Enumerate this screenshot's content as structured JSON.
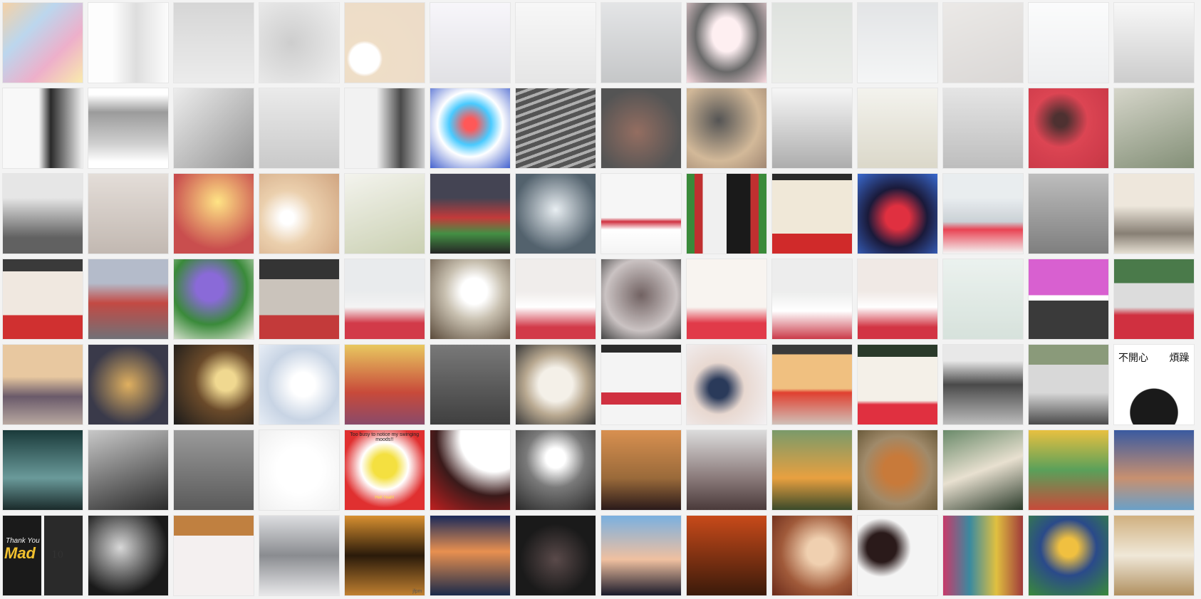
{
  "mosaic": {
    "columns": 14,
    "rows": 7,
    "tiles": [
      {
        "bg": "linear-gradient(135deg,#e89a3a,#6aa5d8,#d84f8a,#f2d24a)",
        "fade": 0.55
      },
      {
        "bg": "linear-gradient(90deg,#f4f4f4 30%,#5a5a5a 60%,#f0f0f0)",
        "fade": 0.8
      },
      {
        "bg": "linear-gradient(180deg,#8a8a8a,#c8c8c8)",
        "fade": 0.65
      },
      {
        "bg": "radial-gradient(circle at 40% 50%,#3a3a3a,#bdbdbd)",
        "fade": 0.75
      },
      {
        "bg": "radial-gradient(circle at 25% 70%,#ffffff 18%,#d0a060 22%,#c89a62)",
        "fade": 0.65
      },
      {
        "bg": "linear-gradient(180deg,#d8d0e8,#6a6a7a)",
        "fade": 0.8
      },
      {
        "bg": "linear-gradient(180deg,#dcdcdc,#8c8c8c)",
        "fade": 0.78
      },
      {
        "bg": "linear-gradient(180deg,#b0b4b8,#5a5e62)",
        "fade": 0.65
      },
      {
        "bg": "radial-gradient(ellipse at 50% 40%,#fde6ea 25%,#1a1a1a 55%,#f6c8d0)",
        "fade": 0.35
      },
      {
        "bg": "linear-gradient(180deg,#6a7a6a,#a8b0a0)",
        "fade": 0.78
      },
      {
        "bg": "linear-gradient(180deg,#9aa0a6,#d8dcde)",
        "fade": 0.72
      },
      {
        "bg": "linear-gradient(160deg,#b8b0a8,#7a706a)",
        "fade": 0.72
      },
      {
        "bg": "linear-gradient(180deg,#f0f2f4,#c0c4c8)",
        "fade": 0.72
      },
      {
        "bg": "linear-gradient(180deg,#e4e4e4,#4a4a4a)",
        "fade": 0.72
      },
      {
        "bg": "linear-gradient(90deg,#f8f8f8 45%,#2a2a2a 60%,#f0f0f0)",
        "fade": 0.0
      },
      {
        "bg": "linear-gradient(180deg,#ffffff 8%,#8a8a8a 30%,#c8c8c8 70%,#ffffff 92%)",
        "fade": 0.15
      },
      {
        "bg": "linear-gradient(135deg,#e8e8e8,#7a7a7a)",
        "fade": 0.2
      },
      {
        "bg": "linear-gradient(180deg,#e6e6e6,#bcbcbc)",
        "fade": 0.2
      },
      {
        "bg": "linear-gradient(90deg,#f0f0f0 40%,#2a2a2a 70%,#c8c8c8)",
        "fade": 0.15
      },
      {
        "bg": "radial-gradient(circle at 50% 45%,#ff5050 10%,#40c8ff 35%,#ffffff 55%,#3a5acc)",
        "fade": 0.05
      },
      {
        "bg": "repeating-linear-gradient(160deg,#2a2a2a 0 6px,#9a9a9a 6px 10px)",
        "fade": 0.2
      },
      {
        "bg": "radial-gradient(circle at 45% 55%,#7a4a3a,#2a2a2a 70%)",
        "fade": 0.2
      },
      {
        "bg": "radial-gradient(circle at 40% 40%,#2a2a2a,#c8a880 60%,#8a6a50)",
        "fade": 0.2
      },
      {
        "bg": "linear-gradient(180deg,#f2f2f2,#8a8a8a)",
        "fade": 0.3
      },
      {
        "bg": "linear-gradient(180deg,#f0efe8,#cfcbb8)",
        "fade": 0.25
      },
      {
        "bg": "linear-gradient(180deg,#dcdcdc,#a8a8a8)",
        "fade": 0.25
      },
      {
        "bg": "radial-gradient(circle at 40% 40%,#3a1a1a 10%,#d83040 40%,#c02030)",
        "fade": 0.1
      },
      {
        "bg": "linear-gradient(160deg,#c8c8b8,#5a6a4a)",
        "fade": 0.25
      },
      {
        "bg": "linear-gradient(180deg,#e0e0e0 30%,#3a3a3a 80%)",
        "fade": 0.2
      },
      {
        "bg": "linear-gradient(180deg,#d8cfc8,#a89a90)",
        "fade": 0.3
      },
      {
        "bg": "radial-gradient(circle at 55% 35%,#ffe070,#c03030 70%)",
        "fade": 0.15
      },
      {
        "bg": "radial-gradient(circle at 35% 55%,#ffffff 10%,#e8c8a0 40%,#c8956a)",
        "fade": 0.15
      },
      {
        "bg": "linear-gradient(160deg,#f0f0e8,#b8c098)",
        "fade": 0.25
      },
      {
        "bg": "linear-gradient(180deg,#3a3a4a 30%,#c03030 55%,#3a8a3a 75%,#1a1a1a)",
        "fade": 0.05
      },
      {
        "bg": "radial-gradient(circle at 50% 45%,#e8eef2,#4a5a66 70%)",
        "fade": 0.05
      },
      {
        "bg": "linear-gradient(180deg,#f6f6f6 55%,#d03040 60%,#ffffff 70%,#f4f4f4)",
        "fade": 0.0
      },
      {
        "bg": "linear-gradient(90deg,#3a8a3a 0 10%,#c03030 10% 20%,#f0f0f0 20% 50%,#1a1a1a 50% 80%,#c03030 80% 90%,#3a8a3a 90%)",
        "fade": 0.0
      },
      {
        "bg": "linear-gradient(180deg,#2a2a2a 0 8%,#f0e8d8 8% 75%,#d02a2a 75%)",
        "fade": 0.0
      },
      {
        "bg": "radial-gradient(circle at 50% 55%,#e03040 20%,#1a1a3a 50%,#3a6ad0)",
        "fade": 0.0
      },
      {
        "bg": "linear-gradient(180deg,#e8ecef 30%,#c8cfd4 60%,#e83a4a 70%,#f4f4f4)",
        "fade": 0.05
      },
      {
        "bg": "linear-gradient(180deg,#9a9a9a,#3a3a3a)",
        "fade": 0.35
      },
      {
        "bg": "linear-gradient(180deg,#eae2d4 40%,#6a6052 75%,#e0d8c8)",
        "fade": 0.2
      },
      {
        "bg": "linear-gradient(180deg,#3a3a3a 0 15%,#f0e8e0 15% 70%,#d03030 70%)",
        "fade": 0.0
      },
      {
        "bg": "linear-gradient(180deg,#b0b8c8 30%,#c0403a 55%,#6a6a70)",
        "fade": 0.05
      },
      {
        "bg": "radial-gradient(circle at 45% 35%,#8a6ad8 20%,#3a8a3a 55%,#f2f0e8)",
        "fade": 0.0
      },
      {
        "bg": "linear-gradient(180deg,#2a2a2a 0 25%,#c8c0b8 25% 70%,#c03030 70%)",
        "fade": 0.05
      },
      {
        "bg": "linear-gradient(180deg,#e8eaec 40%,#f4f4f4 60%,#d03040 80%)",
        "fade": 0.05
      },
      {
        "bg": "radial-gradient(circle at 55% 40%,#ffffff 20%,#c8c0b0 45%,#5a4a3a)",
        "fade": 0.0
      },
      {
        "bg": "linear-gradient(180deg,#f0ecea 40%,#ffffff 60%,#d03040 85%)",
        "fade": 0.05
      },
      {
        "bg": "radial-gradient(circle at 50% 45%,#6a5a5a,#c8c0c0 60%,#3a3a3a)",
        "fade": 0.05
      },
      {
        "bg": "linear-gradient(180deg,#f8f4f0 60%,#e03040 80%)",
        "fade": 0.05
      },
      {
        "bg": "linear-gradient(180deg,#ecedec 40%,#ffffff 65%,#c83040)",
        "fade": 0.05
      },
      {
        "bg": "linear-gradient(180deg,#f0e8e4 40%,#ffffff 60%,#d02a3a 85%)",
        "fade": 0.05
      },
      {
        "bg": "linear-gradient(180deg,#e8f0ec,#d0ddd6)",
        "fade": 0.15
      },
      {
        "bg": "linear-gradient(180deg,#d860d0 0 45%,#ffffff 45% 52%,#3a3a3a 52%)",
        "fade": 0.0
      },
      {
        "bg": "linear-gradient(180deg,#4a7a4a 0 30%,#dcdcdc 30% 60%,#d03040 70%)",
        "fade": 0.0
      },
      {
        "bg": "linear-gradient(180deg,#e8c8a0 40%,#6a5a6a 65%,#b8a8a0)",
        "fade": 0.0
      },
      {
        "bg": "radial-gradient(circle at 50% 50%,#e0b060,#3a3a4a 70%)",
        "fade": 0.0
      },
      {
        "bg": "radial-gradient(circle at 65% 45%,#f0d890 15%,#6a4a2a 45%,#1a1a1a)",
        "fade": 0.0
      },
      {
        "bg": "radial-gradient(circle at 55% 50%,#ffffff 20%,#c8d4e4 60%,#e8eef6)",
        "fade": 0.0
      },
      {
        "bg": "linear-gradient(180deg,#e8c860,#c84a3a 60%,#8a4a6a)",
        "fade": 0.0
      },
      {
        "bg": "linear-gradient(180deg,#6a6a6a,#2a2a2a)",
        "fade": 0.1
      },
      {
        "bg": "radial-gradient(circle at 50% 50%,#f4f0e8 30%,#b8a890 55%,#3a3a3a)",
        "fade": 0.0
      },
      {
        "bg": "linear-gradient(180deg,#2a2a2a 0 10%,#f4f4f4 10% 60%,#d03040 60% 75%,#f4f4f4 75%)",
        "fade": 0.0
      },
      {
        "bg": "radial-gradient(circle at 40% 55%,#2a3a5a 15%,#e8d8d0 40%,#f4f4f8)",
        "fade": 0.0
      },
      {
        "bg": "linear-gradient(180deg,#3a3a3a 0 12%,#f0c080 12% 55%,#e04030 60%,#d0c0b8)",
        "fade": 0.0
      },
      {
        "bg": "linear-gradient(180deg,#2a3a2a 0 15%,#f4f0e8 15% 70%,#e03040 75%)",
        "fade": 0.0
      },
      {
        "bg": "linear-gradient(180deg,#e8e8e8 20%,#4a4a4a 50%,#bcbcbc)",
        "fade": 0.0
      },
      {
        "bg": "linear-gradient(180deg,#8a9a7a 0 25%,#d8d8d8 25% 60%,#4a4a4a)",
        "fade": 0.0
      },
      {
        "bg": "radial-gradient(circle at 50% 85%,#1a1a1a 30%,#ffffff 31%)",
        "fade": 0.0
      },
      {
        "bg": "linear-gradient(180deg,#1a3a3a,#6a9a9a 60%,#1a2a2a)",
        "fade": 0.0
      },
      {
        "bg": "linear-gradient(160deg,#c8c8c8,#2a2a2a)",
        "fade": 0.0
      },
      {
        "bg": "linear-gradient(180deg,#9a9a9a,#5a5a5a)",
        "fade": 0.0
      },
      {
        "bg": "radial-gradient(circle at 50% 50%,#ffffff 40%,#f0f0f0)",
        "fade": 0.0
      },
      {
        "bg": "radial-gradient(circle at 50% 45%,#f4e040 20%,#ffffff 40%,#e03030 70%)",
        "fade": 0.0
      },
      {
        "bg": "radial-gradient(circle at 80% 10%,#ffffff 35%,#3a1a1a 60%,#c02020)",
        "fade": 0.0
      },
      {
        "bg": "radial-gradient(circle at 50% 35%,#ffffff 15%,#7a7a7a 45%,#2a2a2a)",
        "fade": 0.0
      },
      {
        "bg": "linear-gradient(180deg,#d89050,#9a6a3a 60%,#2a1a1a)",
        "fade": 0.0
      },
      {
        "bg": "linear-gradient(180deg,#dcdcdc,#8a7a7a 60%,#4a3a3a)",
        "fade": 0.0
      },
      {
        "bg": "linear-gradient(180deg,#7a9a6a,#e8a040 60%,#3a4a2a)",
        "fade": 0.0
      },
      {
        "bg": "radial-gradient(circle at 50% 50%,#c87a3a 25%,#a08a6a 60%,#6a5a3a)",
        "fade": 0.0
      },
      {
        "bg": "linear-gradient(160deg,#6a8a6a,#e8e0d0 50%,#2a3a2a)",
        "fade": 0.0
      },
      {
        "bg": "linear-gradient(180deg,#e8c040,#5aa05a 50%,#c84a3a)",
        "fade": 0.0
      },
      {
        "bg": "linear-gradient(180deg,#3a5aa0,#c89070 60%,#6aa0c8)",
        "fade": 0.0
      },
      {
        "bg": "linear-gradient(90deg,#1a1a1a 0 48%,#f4f4f4 48% 52%,#2a2a2a 52%)",
        "fade": 0.0
      },
      {
        "bg": "radial-gradient(circle at 40% 40%,#d8d8d8,#1a1a1a 70%)",
        "fade": 0.0
      },
      {
        "bg": "linear-gradient(180deg,#c08040 0 25%,#f4f0f0 25%)",
        "fade": 0.0
      },
      {
        "bg": "linear-gradient(180deg,#dcdde0,#8a8c90 50%,#e8e8ea)",
        "fade": 0.0
      },
      {
        "bg": "linear-gradient(180deg,#d89030,#2a1a0a 50%,#c08030)",
        "fade": 0.0
      },
      {
        "bg": "linear-gradient(180deg,#1a2a5a,#e89050 45%,#1a2a4a)",
        "fade": 0.0
      },
      {
        "bg": "radial-gradient(circle at 50% 55%,#5a4a4a,#1a1a1a 60%)",
        "fade": 0.0
      },
      {
        "bg": "linear-gradient(180deg,#7ab0e0,#f0c0a0 55%,#1a1a2a)",
        "fade": 0.0
      },
      {
        "bg": "linear-gradient(180deg,#c84a1a,#3a1a0a)",
        "fade": 0.0
      },
      {
        "bg": "radial-gradient(circle at 60% 45%,#f0d0b0 20%,#a05a3a 60%,#6a2a1a)",
        "fade": 0.0
      },
      {
        "bg": "radial-gradient(circle at 30% 40%,#2a1a1a 20%,#f4f4f4 40%)",
        "fade": 0.0
      },
      {
        "bg": "linear-gradient(90deg,#c83a6a,#3a8aa0,#e0c040,#a03a3a)",
        "fade": 0.0
      },
      {
        "bg": "radial-gradient(circle at 50% 40%,#f0c040 15%,#2a4a8a 45%,#3a8a3a)",
        "fade": 0.0
      },
      {
        "bg": "linear-gradient(180deg,#d0b080,#f0e8d8 50%,#b09060)",
        "fade": 0.0
      }
    ],
    "captions": {
      "thank_you_top": "Thank You",
      "thank_you_big": "Mad",
      "thank_you_number": "10",
      "moods_text": "Too busy to notice my swinging moods!!",
      "moods_shirt": "Hell Yeah!",
      "bubble_left": "不開心",
      "bubble_right": "煩躁",
      "sunset_signature": "jfpm"
    }
  }
}
